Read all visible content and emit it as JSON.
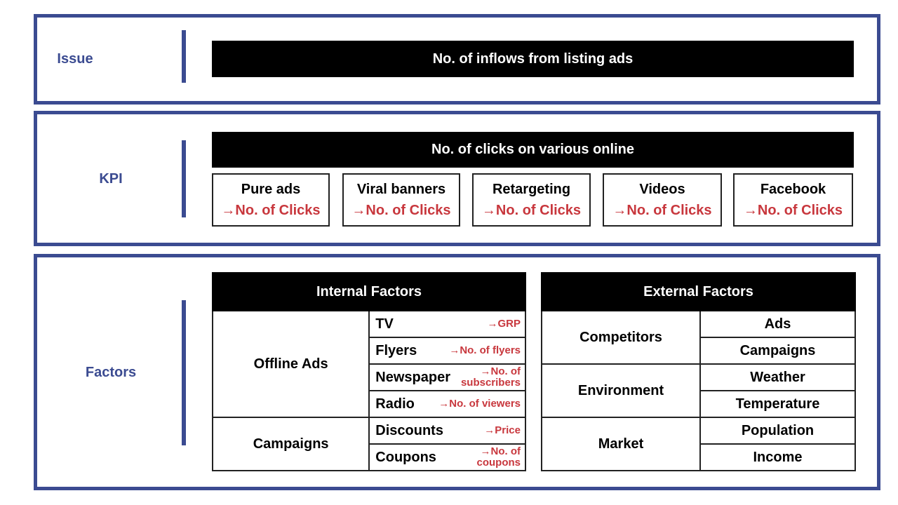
{
  "sections": {
    "issue": {
      "label": "Issue",
      "content": "No. of inflows from listing ads"
    },
    "kpi": {
      "label": "KPI",
      "header": "No. of clicks on various online",
      "items": [
        {
          "title": "Pure ads",
          "metric": "→No. of Clicks"
        },
        {
          "title": "Viral banners",
          "metric": "→No. of Clicks"
        },
        {
          "title": "Retargeting",
          "metric": "→No. of Clicks"
        },
        {
          "title": "Videos",
          "metric": "→No. of Clicks"
        },
        {
          "title": "Facebook",
          "metric": "→No. of Clicks"
        }
      ]
    },
    "factors": {
      "label": "Factors",
      "internal": {
        "header": "Internal Factors",
        "groups": [
          {
            "name": "Offline Ads",
            "items": [
              {
                "name": "TV",
                "metric": "→GRP"
              },
              {
                "name": "Flyers",
                "metric": "→No. of flyers"
              },
              {
                "name": "Newspaper",
                "metric": "→No. of subscribers"
              },
              {
                "name": "Radio",
                "metric": "→No. of viewers"
              }
            ]
          },
          {
            "name": "Campaigns",
            "items": [
              {
                "name": "Discounts",
                "metric": "→Price"
              },
              {
                "name": "Coupons",
                "metric": "→No. of coupons"
              }
            ]
          }
        ]
      },
      "external": {
        "header": "External Factors",
        "groups": [
          {
            "name": "Competitors",
            "items": [
              "Ads",
              "Campaigns"
            ]
          },
          {
            "name": "Environment",
            "items": [
              "Weather",
              "Temperature"
            ]
          },
          {
            "name": "Market",
            "items": [
              "Population",
              "Income"
            ]
          }
        ]
      }
    }
  },
  "colors": {
    "accent": "#3b4b91",
    "metric": "#c8373d",
    "header_bg": "#000000"
  }
}
